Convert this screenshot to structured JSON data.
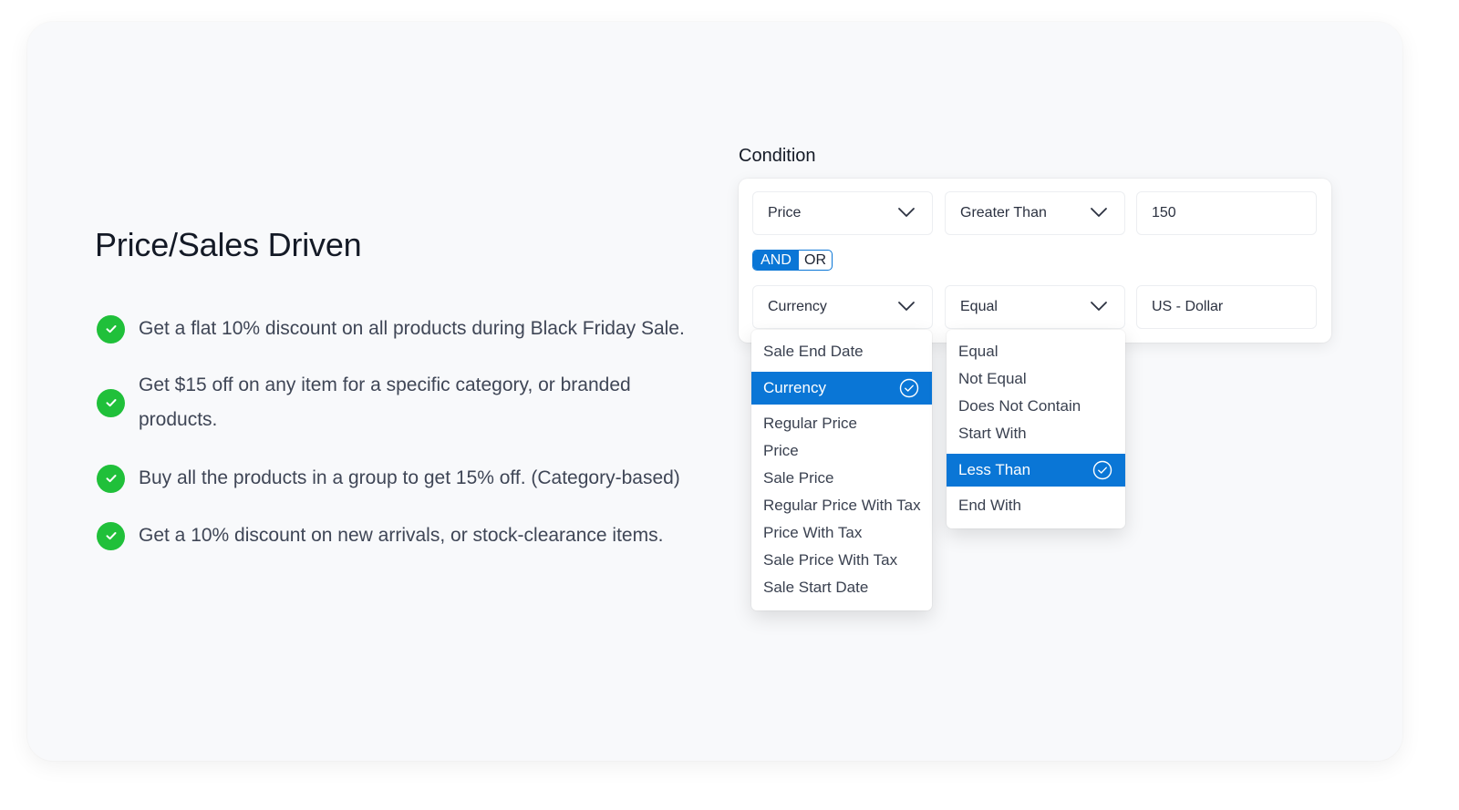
{
  "section": {
    "title": "Price/Sales Driven",
    "features": [
      {
        "icon": "check-circle-icon",
        "text": "Get a flat 10% discount on all products during Black Friday Sale."
      },
      {
        "icon": "check-circle-icon",
        "text": "Get $15 off on any item for a specific category, or branded products."
      },
      {
        "icon": "check-circle-icon",
        "text": "Buy all the products in a group to get 15% off. (Category-based)"
      },
      {
        "icon": "check-circle-icon",
        "text": "Get a 10% discount on new arrivals, or stock-clearance items."
      }
    ]
  },
  "condition": {
    "label": "Condition",
    "row1": {
      "field": "Price",
      "operator": "Greater Than",
      "value": "150"
    },
    "logic": {
      "and_label": "AND",
      "or_label": "OR",
      "selected": "AND"
    },
    "row2": {
      "field": "Currency",
      "operator": "Equal",
      "value": "US - Dollar"
    },
    "field_dropdown": {
      "options": [
        "Sale End Date",
        "Currency",
        "Regular Price",
        "Price",
        "Sale Price",
        "Regular Price With Tax",
        "Price With Tax",
        "Sale Price With Tax",
        "Sale Start Date"
      ],
      "selected": "Currency"
    },
    "operator_dropdown": {
      "options": [
        "Equal",
        "Not Equal",
        "Does Not Contain",
        "Start With",
        "Less Than",
        "End With"
      ],
      "selected": "Less Than"
    }
  },
  "colors": {
    "accent": "#0a76d6",
    "check": "#20c03a",
    "card_bg": "#f8f9fb",
    "text_dark": "#141a26",
    "text_body": "#3f4656"
  }
}
